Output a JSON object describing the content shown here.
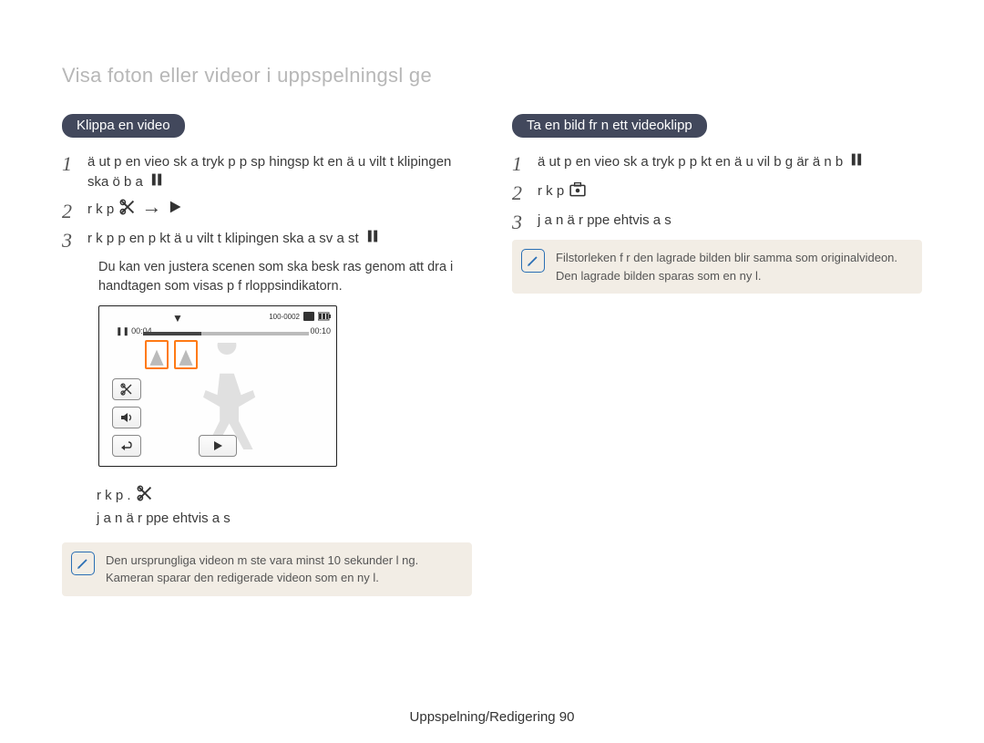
{
  "breadcrumb": "Visa foton eller videor i uppspelningsl ge",
  "left": {
    "heading": "Klippa en video",
    "steps": [
      {
        "num": "1",
        "text": "ä ut p en vieo sk a tryk p        p sp hingsp kt en ä u vilt t klipingen ska  ö b a"
      },
      {
        "num": "2",
        "text": "r k p  "
      },
      {
        "num": "3",
        "text": "r k p        p en p kt ä u vilt t klipingen ska  a sv a st"
      }
    ],
    "note_below_steps": "Du kan   ven justera scenen som ska besk ras genom att dra i handtagen som visas p   f rloppsindikatorn.",
    "screenshot": {
      "file_number": "100-0002",
      "time_left": "00:04",
      "time_right": "00:10"
    },
    "trail_lines": [
      "r k p    .",
      "j a   n ä   r ppe ehtvis a s"
    ],
    "notebox": "Den ursprungliga videon m ste vara minst 10 sekunder l ng. Kameran sparar den redigerade videon som en ny  l."
  },
  "right": {
    "heading": "Ta en bild fr n ett videoklipp",
    "steps": [
      {
        "num": "1",
        "text": "ä ut p en vieo sk a tryk p        p kt en ä u vil b g är ä n  b"
      },
      {
        "num": "2",
        "text": "r k p  "
      },
      {
        "num": "3",
        "text": "j a   n ä   r ppe ehtvis a s"
      }
    ],
    "notebox": "Filstorleken f r den lagrade bilden blir samma som originalvideon. Den lagrade bilden sparas som en ny  l."
  },
  "footer": {
    "section": "Uppspelning/Redigering",
    "page": "90"
  }
}
